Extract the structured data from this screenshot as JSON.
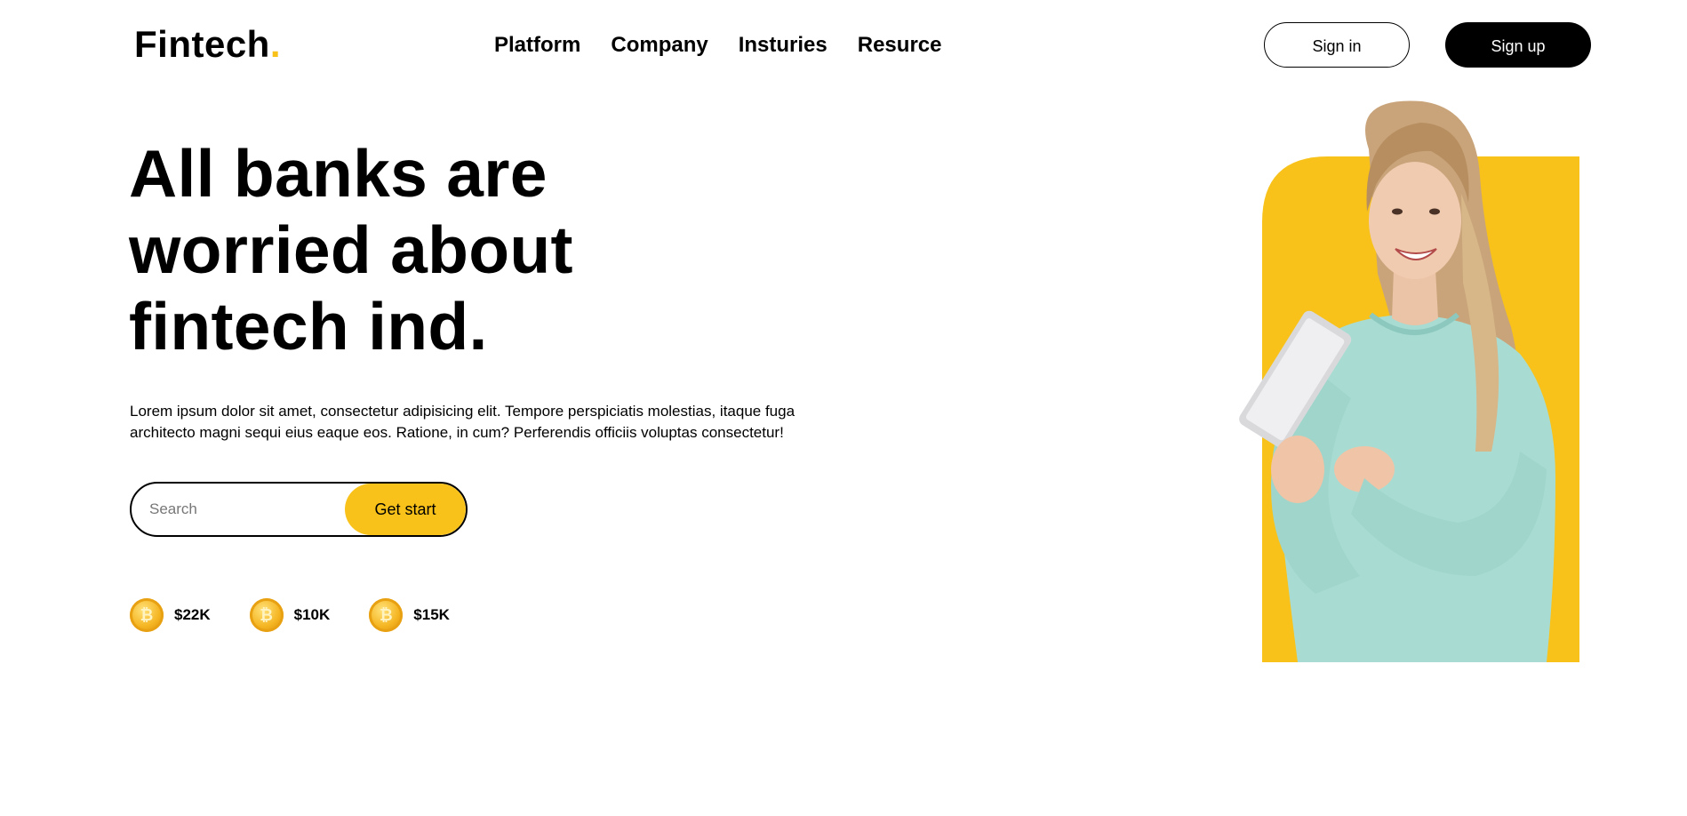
{
  "brand": {
    "name": "Fintech",
    "dot": ".",
    "accent": "#F8C21A"
  },
  "nav": {
    "items": [
      "Platform",
      "Company",
      "Insturies",
      "Resurce"
    ]
  },
  "auth": {
    "signin_label": "Sign in",
    "signup_label": "Sign up"
  },
  "hero": {
    "title_lines": [
      "All banks are",
      "worried about",
      "fintech ind."
    ],
    "description_lines": [
      "Lorem ipsum dolor sit amet, consectetur adipisicing elit. Tempore perspiciatis molestias, itaque fuga",
      "architecto magni sequi eius eaque eos. Ratione, in cum? Perferendis officiis voluptas consectetur!"
    ]
  },
  "search": {
    "placeholder": "Search",
    "button_label": "Get start"
  },
  "stats": [
    {
      "icon": "bitcoin-icon",
      "value": "$22K"
    },
    {
      "icon": "bitcoin-icon",
      "value": "$10K"
    },
    {
      "icon": "bitcoin-icon",
      "value": "$15K"
    }
  ],
  "colors": {
    "primary": "#F8C21A",
    "dark": "#000000",
    "sweater": "#A8DCD3"
  }
}
